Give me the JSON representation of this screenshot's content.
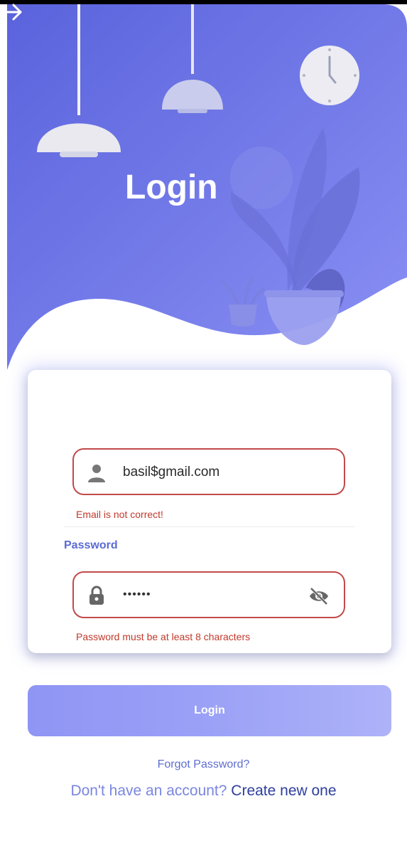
{
  "hero": {
    "title": "Login",
    "arrow_icon": "arrow-right-icon",
    "colors": {
      "gradient_start": "#5a63dc",
      "gradient_end": "#8a90f4"
    }
  },
  "form": {
    "email": {
      "icon": "person-icon",
      "value": "basil$gmail.com",
      "error": "Email is not correct!"
    },
    "password": {
      "label": "Password",
      "icon": "lock-icon",
      "masked_value": "••••••",
      "toggle_icon": "eye-off-icon",
      "error": "Password must be at least 8 characters"
    },
    "colors": {
      "error": "#c0392b",
      "accent": "#5b6bd3"
    }
  },
  "login_button": {
    "label": "Login"
  },
  "forgot_password": {
    "label": "Forgot Password?"
  },
  "signup": {
    "question": "Don't have an account?",
    "link": "Create new one"
  }
}
